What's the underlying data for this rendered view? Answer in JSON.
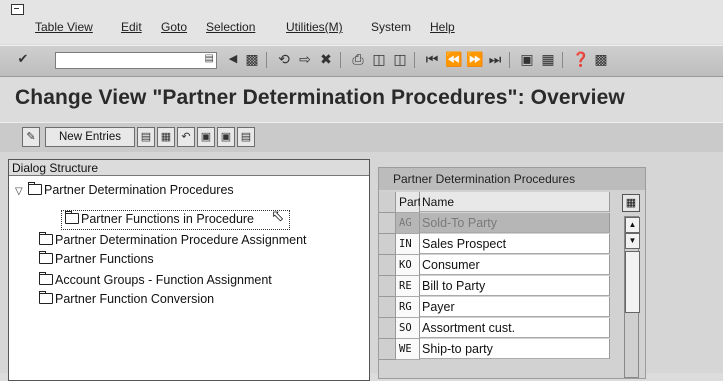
{
  "menu": {
    "items": [
      "Table View",
      "Edit",
      "Goto",
      "Selection",
      "Utilities(M)",
      "System",
      "Help"
    ],
    "underline_index": [
      0,
      0,
      0,
      0,
      0,
      1,
      0
    ]
  },
  "toolbar": {
    "command_field": "",
    "icons": [
      "check-icon",
      "save-icon",
      "back-icon",
      "exit-icon",
      "cancel-icon",
      "print-icon",
      "find-icon",
      "find-next-icon",
      "first-page-icon",
      "previous-page-icon",
      "next-page-icon",
      "last-page-icon",
      "create-session-icon",
      "shortcut-icon",
      "help-icon",
      "layout-icon"
    ]
  },
  "title": "Change View \"Partner Determination Procedures\": Overview",
  "app_toolbar": {
    "new_entries_label": "New Entries"
  },
  "dialog_structure": {
    "header": "Dialog Structure",
    "items": [
      "Partner Determination Procedures",
      "Partner Functions in Procedure",
      "Partner Determination Procedure Assignment",
      "Partner Functions",
      "Account Groups - Function Assignment",
      "Partner Function Conversion"
    ]
  },
  "table": {
    "title": "Partner Determination Procedures",
    "columns": [
      "Part...",
      "Name"
    ],
    "rows": [
      {
        "code": "AG",
        "name": "Sold-To Party"
      },
      {
        "code": "IN",
        "name": "Sales Prospect"
      },
      {
        "code": "KO",
        "name": "Consumer"
      },
      {
        "code": "RE",
        "name": "Bill to Party"
      },
      {
        "code": "RG",
        "name": "Payer"
      },
      {
        "code": "SO",
        "name": "Assortment cust."
      },
      {
        "code": "WE",
        "name": "Ship-to party"
      }
    ]
  }
}
